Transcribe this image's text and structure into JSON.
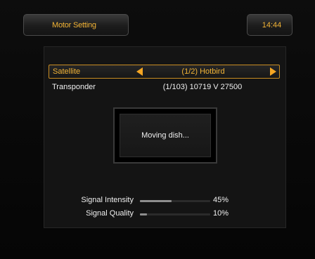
{
  "header": {
    "title": "Motor Setting",
    "clock": "14:44"
  },
  "satellite": {
    "label": "Satellite",
    "value": "(1/2) Hotbird"
  },
  "transponder": {
    "label": "Transponder",
    "value": "(1/103) 10719 V 27500"
  },
  "message": "Moving dish...",
  "signal": {
    "intensity": {
      "label": "Signal Intensity",
      "percent": 45,
      "text": "45%"
    },
    "quality": {
      "label": "Signal Quality",
      "percent": 10,
      "text": "10%"
    }
  },
  "colors": {
    "accent": "#f3b436",
    "arrow": "#f5a623",
    "text": "#f0f0f0",
    "background": "#000000"
  }
}
